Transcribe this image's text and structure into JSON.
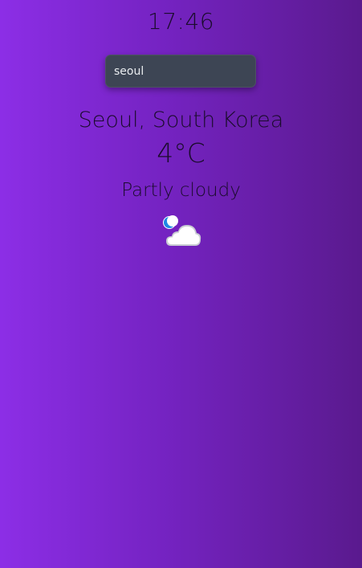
{
  "clock": {
    "time": "17:46"
  },
  "search": {
    "value": "seoul",
    "placeholder": ""
  },
  "weather": {
    "location": "Seoul, South Korea",
    "temperature": "4°C",
    "condition": "Partly cloudy",
    "icon": "moon-cloud-icon"
  },
  "colors": {
    "background_start": "#8c2ee6",
    "background_end": "#5a1a8e",
    "search_background": "#3d4554",
    "text": "#1b0c2d",
    "moon": "#1e88e5"
  }
}
